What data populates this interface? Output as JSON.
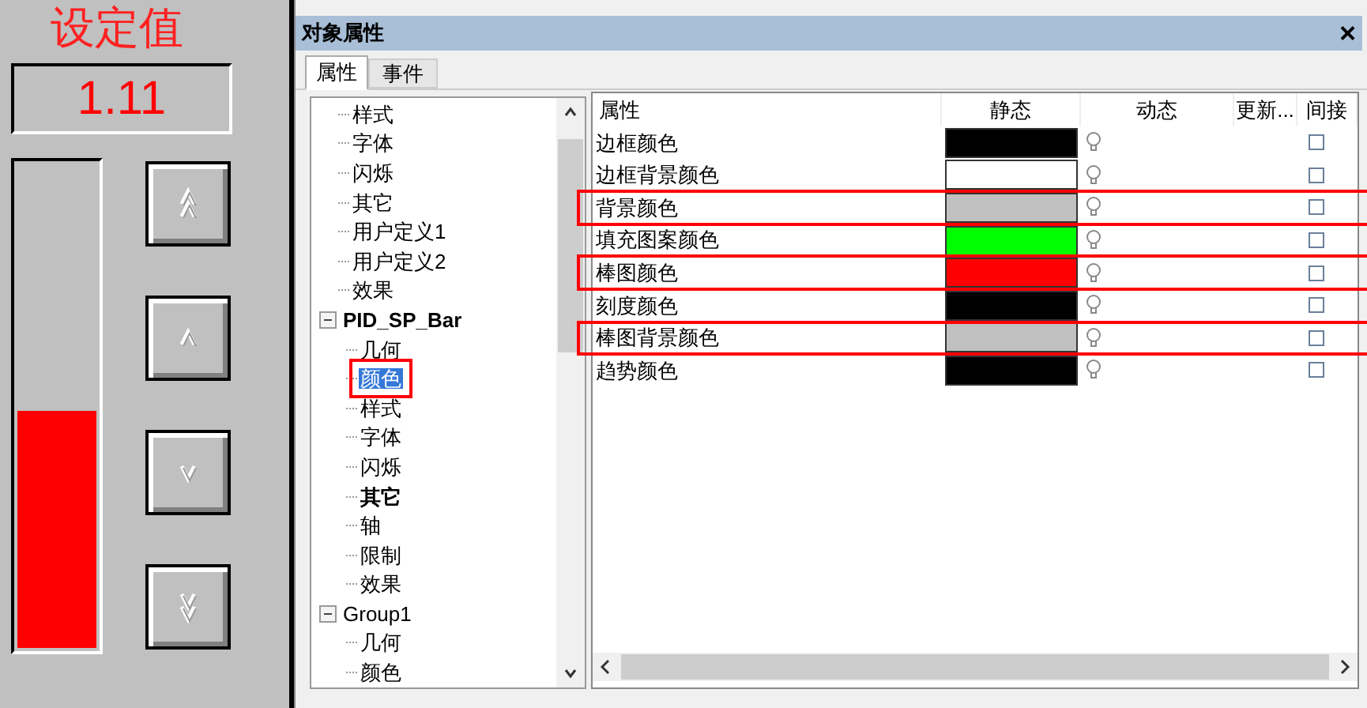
{
  "panel": {
    "title": "设定值",
    "value": "1.11",
    "bar": {
      "level": 0.49
    },
    "buttons": [
      {
        "kind": "double_up"
      },
      {
        "kind": "up"
      },
      {
        "kind": "down"
      },
      {
        "kind": "double_down"
      }
    ]
  },
  "window": {
    "title": "对象属性",
    "close": "×"
  },
  "tabs": [
    {
      "label": "属性",
      "selected": true
    },
    {
      "label": "事件",
      "selected": false
    }
  ],
  "tree": [
    {
      "label": "样式",
      "selected": false
    },
    {
      "label": "字体",
      "selected": false
    },
    {
      "label": "闪烁",
      "selected": false
    },
    {
      "label": "其它",
      "selected": false
    },
    {
      "label": "用户定义1",
      "selected": false
    },
    {
      "label": "用户定义2",
      "selected": false
    },
    {
      "label": "效果",
      "selected": false
    },
    {
      "label": "PID_SP_Bar",
      "bold": true,
      "expanded": true,
      "selected": false,
      "children": [
        {
          "label": "几何",
          "selected": false
        },
        {
          "label": "颜色",
          "selected": true,
          "highlighted": true
        },
        {
          "label": "样式",
          "selected": false
        },
        {
          "label": "字体",
          "selected": false
        },
        {
          "label": "闪烁",
          "selected": false
        },
        {
          "label": "其它",
          "bold": true,
          "selected": false
        },
        {
          "label": "轴",
          "selected": false
        },
        {
          "label": "限制",
          "selected": false
        },
        {
          "label": "效果",
          "selected": false
        }
      ]
    },
    {
      "label": "Group1",
      "expanded": true,
      "selected": false,
      "children": [
        {
          "label": "几何",
          "selected": false
        },
        {
          "label": "颜色",
          "selected": false
        }
      ]
    }
  ],
  "grid": {
    "columns": [
      "属性",
      "静态",
      "动态",
      "更新...",
      "间接"
    ],
    "rows": [
      {
        "name": "边框颜色",
        "color": "#000000",
        "highlighted": false,
        "checked": false
      },
      {
        "name": "边框背景颜色",
        "color": "#ffffff",
        "highlighted": false,
        "checked": false
      },
      {
        "name": "背景颜色",
        "color": "#c0c0c0",
        "highlighted": true,
        "checked": false
      },
      {
        "name": "填充图案颜色",
        "color": "#00ff00",
        "highlighted": false,
        "checked": false
      },
      {
        "name": "棒图颜色",
        "color": "#ff0000",
        "highlighted": true,
        "checked": false
      },
      {
        "name": "刻度颜色",
        "color": "#000000",
        "highlighted": false,
        "checked": false
      },
      {
        "name": "棒图背景颜色",
        "color": "#c0c0c0",
        "highlighted": true,
        "checked": false
      },
      {
        "name": "趋势颜色",
        "color": "#000000",
        "highlighted": false,
        "checked": false
      }
    ]
  }
}
